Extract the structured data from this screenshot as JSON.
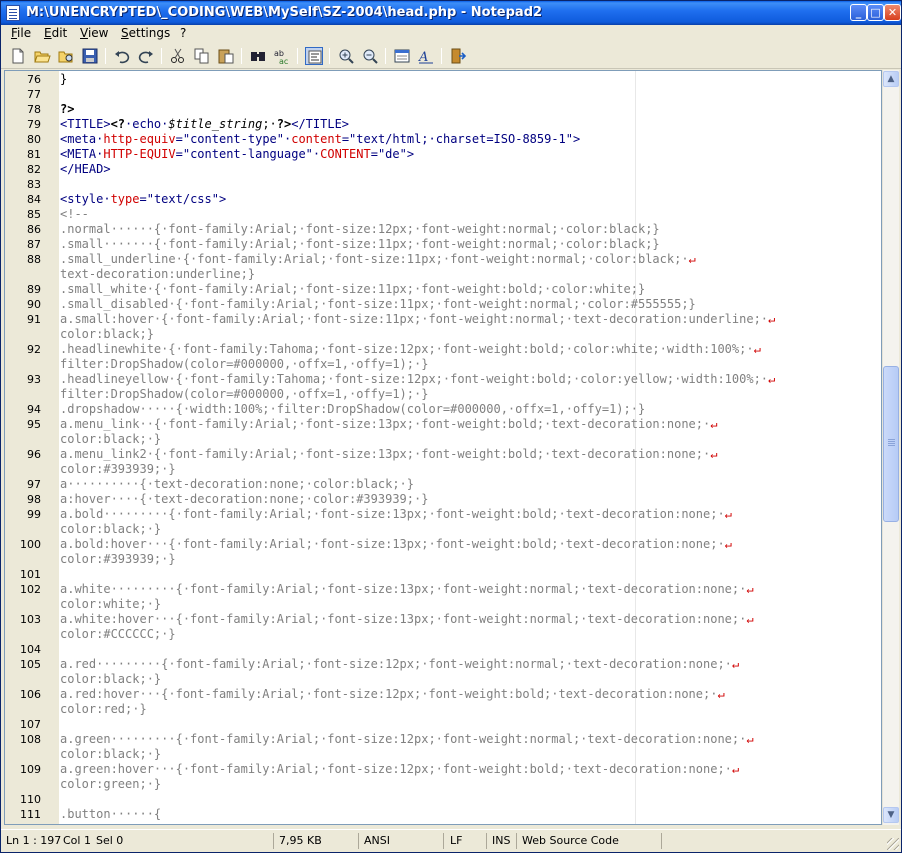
{
  "window": {
    "title": "M:\\UNENCRYPTED\\_CODING\\WEB\\MySelf\\SZ-2004\\head.php - Notepad2",
    "minimize_label": "_",
    "maximize_label": "□",
    "close_label": "✕"
  },
  "menu": [
    {
      "label": "File"
    },
    {
      "label": "Edit"
    },
    {
      "label": "View"
    },
    {
      "label": "Settings"
    },
    {
      "label": "?"
    }
  ],
  "toolbar": [
    {
      "icon": "new-file-icon"
    },
    {
      "icon": "open-folder-icon"
    },
    {
      "icon": "browse-icon"
    },
    {
      "icon": "save-icon"
    },
    {
      "icon": "undo-icon"
    },
    {
      "icon": "redo-icon"
    },
    {
      "icon": "cut-icon"
    },
    {
      "icon": "copy-icon"
    },
    {
      "icon": "paste-icon"
    },
    {
      "icon": "find-icon"
    },
    {
      "icon": "replace-icon"
    },
    {
      "icon": "word-wrap-icon"
    },
    {
      "icon": "zoom-in-icon"
    },
    {
      "icon": "zoom-out-icon"
    },
    {
      "icon": "scheme-icon"
    },
    {
      "icon": "font-icon"
    },
    {
      "icon": "exit-icon"
    }
  ],
  "editor": {
    "lines": [
      {
        "n": "76",
        "parts": [
          [
            "plain",
            "}"
          ]
        ]
      },
      {
        "n": "77",
        "parts": []
      },
      {
        "n": "78",
        "parts": [
          [
            "php",
            "?>"
          ]
        ]
      },
      {
        "n": "79",
        "parts": [
          [
            "tag",
            "<TITLE>"
          ],
          [
            "php",
            "<?"
          ],
          [
            "kw",
            "·echo·"
          ],
          [
            "var",
            "$title_string"
          ],
          [
            "plain",
            ";·"
          ],
          [
            "php",
            "?>"
          ],
          [
            "tag",
            "</TITLE>"
          ]
        ]
      },
      {
        "n": "80",
        "parts": [
          [
            "tag",
            "<meta·"
          ],
          [
            "attr",
            "http-equiv"
          ],
          [
            "tag",
            "="
          ],
          [
            "str",
            "\"content-type\""
          ],
          [
            "tag",
            "·"
          ],
          [
            "attr",
            "content"
          ],
          [
            "tag",
            "="
          ],
          [
            "str",
            "\"text/html;·charset=ISO-8859-1\""
          ],
          [
            "tag",
            ">"
          ]
        ]
      },
      {
        "n": "81",
        "parts": [
          [
            "tag",
            "<META·"
          ],
          [
            "attr",
            "HTTP-EQUIV"
          ],
          [
            "tag",
            "="
          ],
          [
            "str",
            "\"content-language\""
          ],
          [
            "tag",
            "·"
          ],
          [
            "attr",
            "CONTENT"
          ],
          [
            "tag",
            "="
          ],
          [
            "str",
            "\"de\""
          ],
          [
            "tag",
            ">"
          ]
        ]
      },
      {
        "n": "82",
        "parts": [
          [
            "tag",
            "</HEAD>"
          ]
        ]
      },
      {
        "n": "83",
        "parts": []
      },
      {
        "n": "84",
        "parts": [
          [
            "tag",
            "<style·"
          ],
          [
            "attr",
            "type"
          ],
          [
            "tag",
            "="
          ],
          [
            "str",
            "\"text/css\""
          ],
          [
            "tag",
            ">"
          ]
        ]
      },
      {
        "n": "85",
        "parts": [
          [
            "css",
            "<!--"
          ]
        ]
      },
      {
        "n": "86",
        "parts": [
          [
            "css",
            ".normal······{·font-family:Arial;·font-size:12px;·font-weight:normal;·color:black;}"
          ]
        ]
      },
      {
        "n": "87",
        "parts": [
          [
            "css",
            ".small·······{·font-family:Arial;·font-size:11px;·font-weight:normal;·color:black;}"
          ]
        ]
      },
      {
        "n": "88",
        "parts": [
          [
            "css",
            ".small_underline·{·font-family:Arial;·font-size:11px;·font-weight:normal;·color:black;·"
          ],
          [
            "wrap",
            "↵"
          ]
        ]
      },
      {
        "n": "",
        "parts": [
          [
            "css",
            "text-decoration:underline;}"
          ]
        ]
      },
      {
        "n": "89",
        "parts": [
          [
            "css",
            ".small_white·{·font-family:Arial;·font-size:11px;·font-weight:bold;·color:white;}"
          ]
        ]
      },
      {
        "n": "90",
        "parts": [
          [
            "css",
            ".small_disabled·{·font-family:Arial;·font-size:11px;·font-weight:normal;·color:#555555;}"
          ]
        ]
      },
      {
        "n": "91",
        "parts": [
          [
            "css",
            "a.small:hover·{·font-family:Arial;·font-size:11px;·font-weight:normal;·text-decoration:underline;·"
          ],
          [
            "wrap",
            "↵"
          ]
        ]
      },
      {
        "n": "",
        "parts": [
          [
            "css",
            "color:black;}"
          ]
        ]
      },
      {
        "n": "92",
        "parts": [
          [
            "css",
            ".headlinewhite·{·font-family:Tahoma;·font-size:12px;·font-weight:bold;·color:white;·width:100%;·"
          ],
          [
            "wrap",
            "↵"
          ]
        ]
      },
      {
        "n": "",
        "parts": [
          [
            "css",
            "filter:DropShadow(color=#000000,·offx=1,·offy=1);·}"
          ]
        ]
      },
      {
        "n": "93",
        "parts": [
          [
            "css",
            ".headlineyellow·{·font-family:Tahoma;·font-size:12px;·font-weight:bold;·color:yellow;·width:100%;·"
          ],
          [
            "wrap",
            "↵"
          ]
        ]
      },
      {
        "n": "",
        "parts": [
          [
            "css",
            "filter:DropShadow(color=#000000,·offx=1,·offy=1);·}"
          ]
        ]
      },
      {
        "n": "94",
        "parts": [
          [
            "css",
            ".dropshadow·····{·width:100%;·filter:DropShadow(color=#000000,·offx=1,·offy=1);·}"
          ]
        ]
      },
      {
        "n": "95",
        "parts": [
          [
            "css",
            "a.menu_link··{·font-family:Arial;·font-size:13px;·font-weight:bold;·text-decoration:none;·"
          ],
          [
            "wrap",
            "↵"
          ]
        ]
      },
      {
        "n": "",
        "parts": [
          [
            "css",
            "color:black;·}"
          ]
        ]
      },
      {
        "n": "96",
        "parts": [
          [
            "css",
            "a.menu_link2·{·font-family:Arial;·font-size:13px;·font-weight:bold;·text-decoration:none;·"
          ],
          [
            "wrap",
            "↵"
          ]
        ]
      },
      {
        "n": "",
        "parts": [
          [
            "css",
            "color:#393939;·}"
          ]
        ]
      },
      {
        "n": "97",
        "parts": [
          [
            "css",
            "a··········{·text-decoration:none;·color:black;·}"
          ]
        ]
      },
      {
        "n": "98",
        "parts": [
          [
            "css",
            "a:hover····{·text-decoration:none;·color:#393939;·}"
          ]
        ]
      },
      {
        "n": "99",
        "parts": [
          [
            "css",
            "a.bold·········{·font-family:Arial;·font-size:13px;·font-weight:bold;·text-decoration:none;·"
          ],
          [
            "wrap",
            "↵"
          ]
        ]
      },
      {
        "n": "",
        "parts": [
          [
            "css",
            "color:black;·}"
          ]
        ]
      },
      {
        "n": "100",
        "parts": [
          [
            "css",
            "a.bold:hover···{·font-family:Arial;·font-size:13px;·font-weight:bold;·text-decoration:none;·"
          ],
          [
            "wrap",
            "↵"
          ]
        ]
      },
      {
        "n": "",
        "parts": [
          [
            "css",
            "color:#393939;·}"
          ]
        ]
      },
      {
        "n": "101",
        "parts": []
      },
      {
        "n": "102",
        "parts": [
          [
            "css",
            "a.white·········{·font-family:Arial;·font-size:13px;·font-weight:normal;·text-decoration:none;·"
          ],
          [
            "wrap",
            "↵"
          ]
        ]
      },
      {
        "n": "",
        "parts": [
          [
            "css",
            "color:white;·}"
          ]
        ]
      },
      {
        "n": "103",
        "parts": [
          [
            "css",
            "a.white:hover···{·font-family:Arial;·font-size:13px;·font-weight:normal;·text-decoration:none;·"
          ],
          [
            "wrap",
            "↵"
          ]
        ]
      },
      {
        "n": "",
        "parts": [
          [
            "css",
            "color:#CCCCCC;·}"
          ]
        ]
      },
      {
        "n": "104",
        "parts": []
      },
      {
        "n": "105",
        "parts": [
          [
            "css",
            "a.red·········{·font-family:Arial;·font-size:12px;·font-weight:normal;·text-decoration:none;·"
          ],
          [
            "wrap",
            "↵"
          ]
        ]
      },
      {
        "n": "",
        "parts": [
          [
            "css",
            "color:black;·}"
          ]
        ]
      },
      {
        "n": "106",
        "parts": [
          [
            "css",
            "a.red:hover···{·font-family:Arial;·font-size:12px;·font-weight:bold;·text-decoration:none;·"
          ],
          [
            "wrap",
            "↵"
          ]
        ]
      },
      {
        "n": "",
        "parts": [
          [
            "css",
            "color:red;·}"
          ]
        ]
      },
      {
        "n": "107",
        "parts": []
      },
      {
        "n": "108",
        "parts": [
          [
            "css",
            "a.green·········{·font-family:Arial;·font-size:12px;·font-weight:normal;·text-decoration:none;·"
          ],
          [
            "wrap",
            "↵"
          ]
        ]
      },
      {
        "n": "",
        "parts": [
          [
            "css",
            "color:black;·}"
          ]
        ]
      },
      {
        "n": "109",
        "parts": [
          [
            "css",
            "a.green:hover···{·font-family:Arial;·font-size:12px;·font-weight:bold;·text-decoration:none;·"
          ],
          [
            "wrap",
            "↵"
          ]
        ]
      },
      {
        "n": "",
        "parts": [
          [
            "css",
            "color:green;·}"
          ]
        ]
      },
      {
        "n": "110",
        "parts": []
      },
      {
        "n": "111",
        "parts": [
          [
            "css",
            ".button······{"
          ]
        ]
      }
    ]
  },
  "statusbar": {
    "position": "Ln 1 : 197",
    "col": "Col 1",
    "sel": "Sel 0",
    "size": "7,95 KB",
    "encoding": "ANSI",
    "eol": "LF",
    "ovr": "INS",
    "scheme": "Web Source Code"
  },
  "colors": {
    "titlebar": "#0F5BDC",
    "chrome": "#ECE9D8",
    "tag": "#000080",
    "attr": "#D00000",
    "css": "#808080"
  }
}
